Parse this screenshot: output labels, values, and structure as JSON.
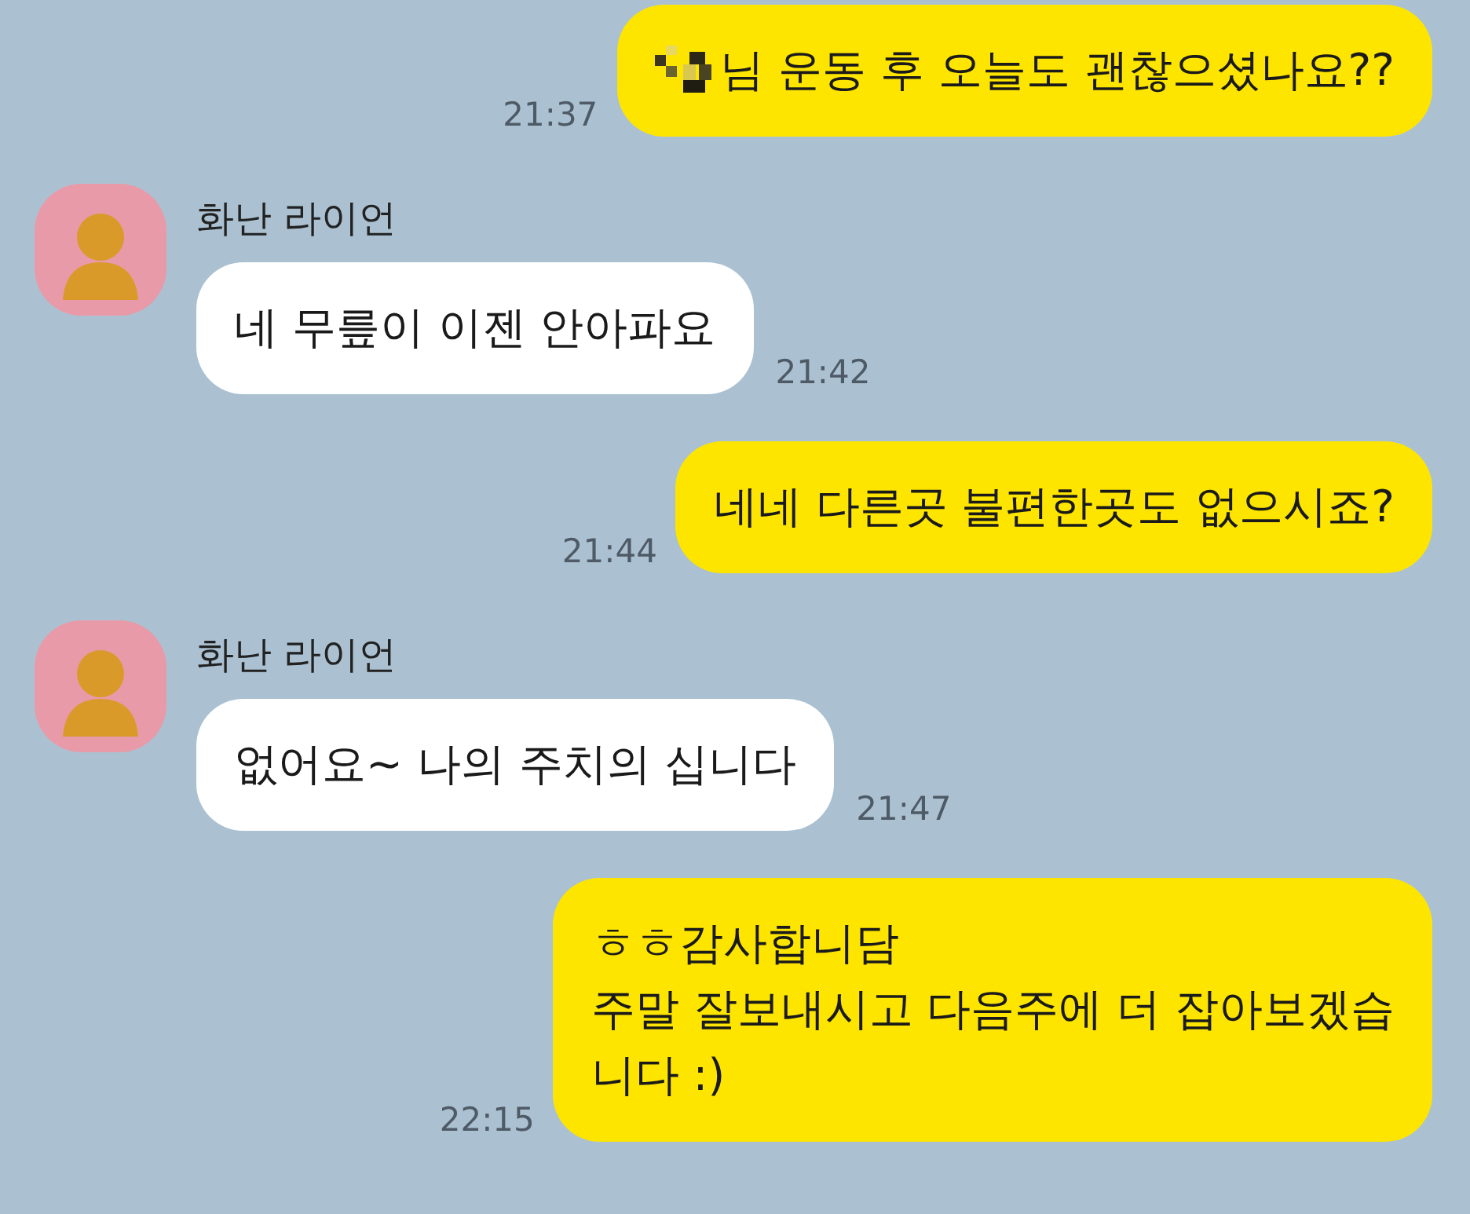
{
  "messages": [
    {
      "kind": "sent",
      "redacted": true,
      "text": "님 운동 후 오늘도 괜찮으셨나요??",
      "time": "21:37"
    },
    {
      "kind": "received",
      "sender": "화난 라이언",
      "text": "네 무릎이 이젠 안아파요",
      "time": "21:42"
    },
    {
      "kind": "sent",
      "redacted": false,
      "text": "네네 다른곳 불편한곳도 없으시죠?",
      "time": "21:44"
    },
    {
      "kind": "received",
      "sender": "화난 라이언",
      "text": "없어요~ 나의 주치의 십니다",
      "time": "21:47"
    },
    {
      "kind": "sent",
      "redacted": false,
      "text": "ㅎㅎ감사합니담\n주말 잘보내시고 다음주에 더 잡아보겠습\n니다 :)",
      "time": "22:15"
    }
  ]
}
